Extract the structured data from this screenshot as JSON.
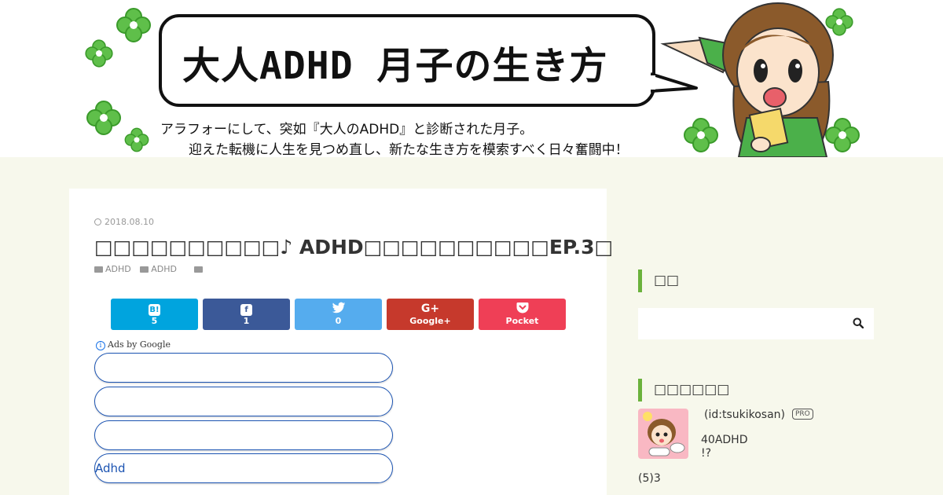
{
  "header": {
    "banner_title": "大人ADHD 月子の生き方",
    "subtitle_line1": "アラフォーにして、突如『大人のADHD』と診断された月子。",
    "subtitle_line2": "迎えた転機に人生を見つめ直し、新たな生き方を模索すべく日々奮闘中！"
  },
  "article": {
    "date": "2018.08.10",
    "title": "□□□□□□□□□□♪ ADHD□□□□□□□□□□EP.3□",
    "categories": [
      "ADHD",
      "ADHD",
      ""
    ],
    "share": [
      {
        "icon": "hatena-bookmark-icon",
        "glyph": "B!",
        "count": "5",
        "color": "#00a4de"
      },
      {
        "icon": "facebook-icon",
        "glyph": "f",
        "count": "1",
        "color": "#3b5998"
      },
      {
        "icon": "twitter-icon",
        "glyph": "🐦",
        "count": "0",
        "color": "#55acee"
      },
      {
        "icon": "google-plus-icon",
        "glyph": "G+",
        "count": "Google+",
        "color": "#c6392c"
      },
      {
        "icon": "pocket-icon",
        "glyph": "⌄",
        "count": "Pocket",
        "color": "#ef3f56"
      }
    ],
    "ads_label": "Ads by Google",
    "ad_links": [
      "",
      "",
      "",
      "Adhd"
    ]
  },
  "sidebar": {
    "search_heading": "□□",
    "profile_heading": "□□□□□□",
    "profile_id": "(id:tsukikosan)",
    "pro_badge": "PRO",
    "profile_line1": "40ADHD",
    "profile_line2": "!?",
    "profile_footer": "(5)3"
  },
  "colors": {
    "accent_green": "#6bb23c",
    "page_bg": "#f7f8ec",
    "ad_link_blue": "#1c54b2"
  }
}
